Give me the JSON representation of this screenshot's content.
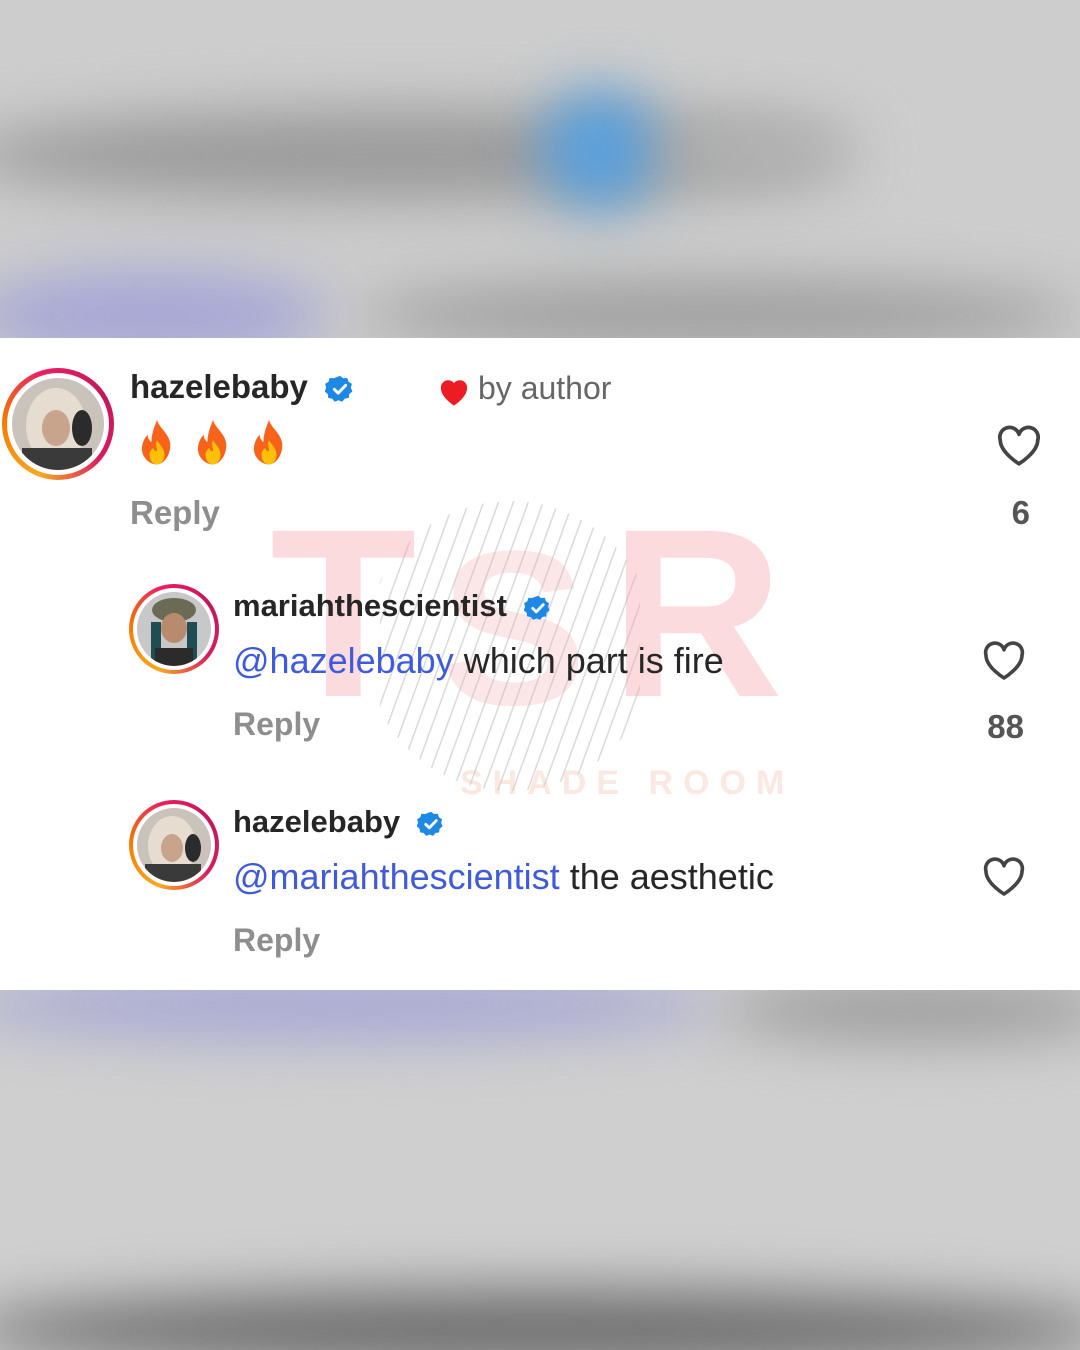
{
  "comments": [
    {
      "username": "hazelebaby",
      "verified": true,
      "badge_label": "by author",
      "text": "",
      "reply_label": "Reply",
      "like_count": "6"
    },
    {
      "username": "mariahthescientist",
      "verified": true,
      "mention": "@hazelebaby",
      "text": "which part is fire",
      "reply_label": "Reply",
      "like_count": "88"
    },
    {
      "username": "hazelebaby",
      "verified": true,
      "mention": "@mariahthescientist",
      "text": "the aesthetic",
      "reply_label": "Reply"
    }
  ],
  "watermark": {
    "letters": [
      "T",
      "S",
      "R"
    ],
    "subtitle": "SHADE ROOM"
  },
  "colors": {
    "verified": "#1e88e5",
    "mention": "#3f5bd9",
    "heart_liked": "#ed1c24",
    "reply_gray": "#8e8e8e"
  },
  "icons": [
    "verified-badge-icon",
    "heart-filled-icon",
    "fire-emoji-icon",
    "heart-outline-icon"
  ]
}
